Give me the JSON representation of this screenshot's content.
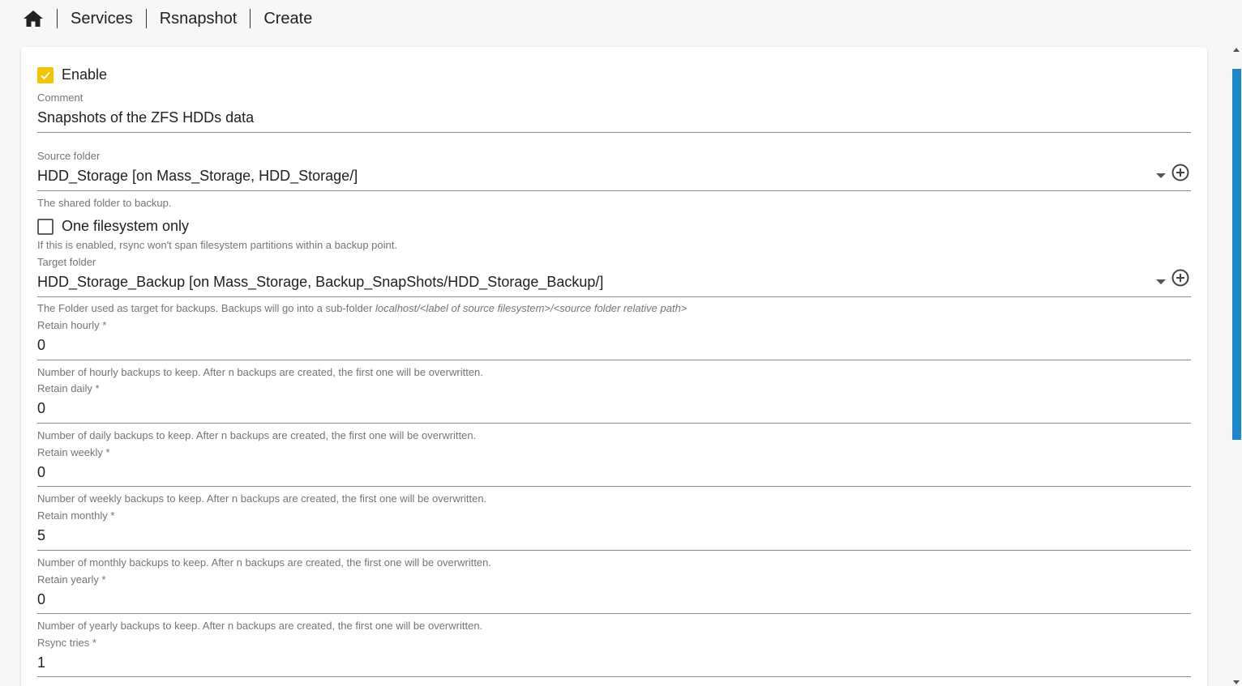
{
  "breadcrumb": {
    "items": [
      "Services",
      "Rsnapshot",
      "Create"
    ]
  },
  "form": {
    "enable": {
      "label": "Enable",
      "checked": true
    },
    "comment": {
      "label": "Comment",
      "value": "Snapshots of the ZFS HDDs data"
    },
    "source_folder": {
      "label": "Source folder",
      "value": "HDD_Storage [on Mass_Storage, HDD_Storage/]",
      "hint": "The shared folder to backup."
    },
    "one_filesystem": {
      "label": "One filesystem only",
      "checked": false,
      "hint": "If this is enabled, rsync won't span filesystem partitions within a backup point."
    },
    "target_folder": {
      "label": "Target folder",
      "value": "HDD_Storage_Backup [on Mass_Storage, Backup_SnapShots/HDD_Storage_Backup/]",
      "hint_prefix": "The Folder used as target for backups. Backups will go into a sub-folder ",
      "hint_path": "localhost/<label of source filesystem>/<source folder relative path>"
    },
    "retain_hourly": {
      "label": "Retain hourly *",
      "value": "0",
      "hint": "Number of hourly backups to keep. After n backups are created, the first one will be overwritten."
    },
    "retain_daily": {
      "label": "Retain daily *",
      "value": "0",
      "hint": "Number of daily backups to keep. After n backups are created, the first one will be overwritten."
    },
    "retain_weekly": {
      "label": "Retain weekly *",
      "value": "0",
      "hint": "Number of weekly backups to keep. After n backups are created, the first one will be overwritten."
    },
    "retain_monthly": {
      "label": "Retain monthly *",
      "value": "5",
      "hint": "Number of monthly backups to keep. After n backups are created, the first one will be overwritten."
    },
    "retain_yearly": {
      "label": "Retain yearly *",
      "value": "0",
      "hint": "Number of yearly backups to keep. After n backups are created, the first one will be overwritten."
    },
    "rsync_tries": {
      "label": "Rsync tries *",
      "value": "1"
    }
  },
  "colors": {
    "checkbox_accent": "#f5c400",
    "scrollbar": "#1d87c9"
  }
}
